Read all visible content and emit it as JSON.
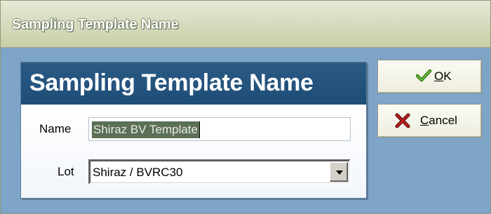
{
  "window": {
    "title": "Sampling Template Name"
  },
  "panel": {
    "heading": "Sampling Template Name",
    "name_label": "Name",
    "name_value": "Shiraz BV Template",
    "lot_label": "Lot",
    "lot_value": "Shiraz / BVRC30"
  },
  "buttons": {
    "ok": {
      "mnemonic": "O",
      "rest": "K",
      "icon": "checkmark-icon"
    },
    "cancel": {
      "mnemonic": "C",
      "rest": "ancel",
      "icon": "cross-icon"
    }
  },
  "colors": {
    "panel_header": "#1e4e78",
    "client_background": "#7ea5c7",
    "selection": "#5c6f57",
    "ok_icon": "#3f8a1e",
    "cancel_icon": "#a01414"
  }
}
